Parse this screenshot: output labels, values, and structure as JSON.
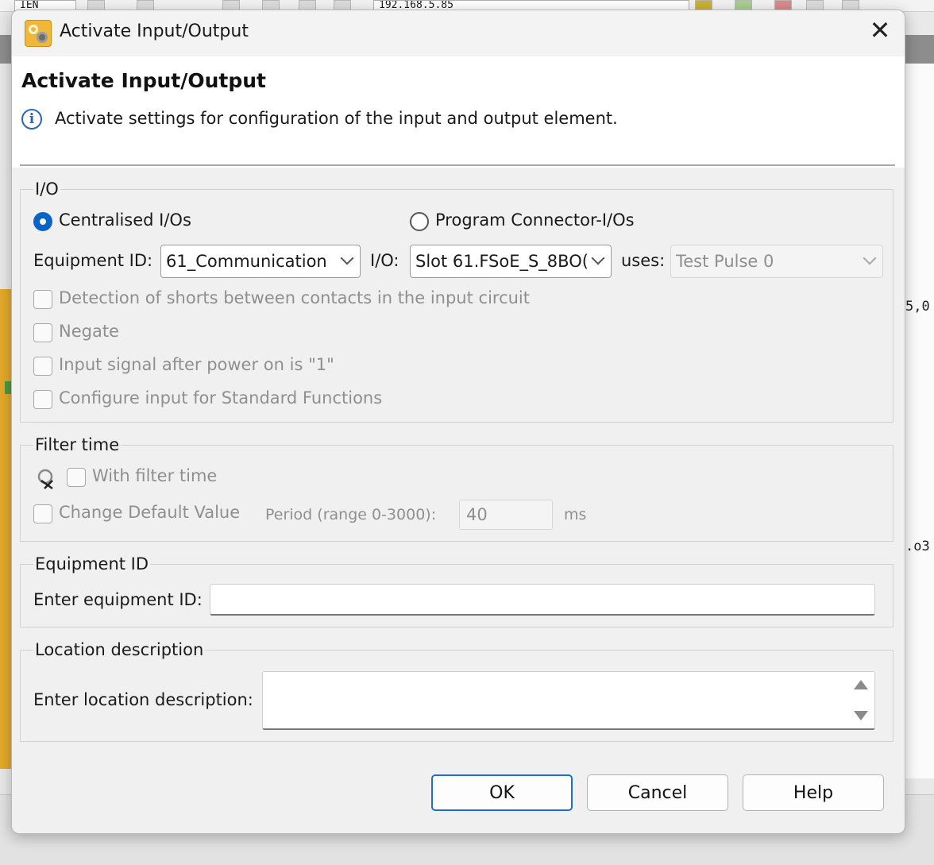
{
  "background": {
    "toolbar_combo_left": "IEN",
    "toolbar_ip": "192.168.5.85",
    "right_text_1": "5,0",
    "right_text_2": ".o3"
  },
  "dialog": {
    "title": "Activate Input/Output",
    "close_glyph": "✕",
    "heading": "Activate Input/Output",
    "info_glyph": "i",
    "description": "Activate settings for configuration of the input and output element."
  },
  "io": {
    "legend": "I/O",
    "radio_centralised": "Centralised I/Os",
    "radio_program_connector": "Program Connector-I/Os",
    "selected": "Centralised I/Os",
    "equipment_id_label": "Equipment ID:",
    "equipment_id_value": "61_Communication",
    "io_label": "I/O:",
    "io_value": "Slot 61.FSoE_S_8BO(",
    "uses_label": "uses:",
    "uses_value": "Test Pulse 0",
    "checkboxes": [
      "Detection of shorts between contacts in the input circuit",
      "Negate",
      "Input signal after power on is \"1\"",
      "Configure input for Standard Functions"
    ]
  },
  "filter": {
    "legend": "Filter time",
    "with_filter_time": "With filter time",
    "change_default": "Change Default Value",
    "period_label": "Period (range 0-3000):",
    "period_value": "40",
    "unit": "ms"
  },
  "equipment": {
    "legend": "Equipment ID",
    "label": "Enter equipment ID:",
    "value": ""
  },
  "location": {
    "legend": "Location description",
    "label": "Enter location description:",
    "value": ""
  },
  "buttons": {
    "ok": "OK",
    "cancel": "Cancel",
    "help": "Help"
  },
  "colors": {
    "accent": "#0a64c8",
    "primary_border": "#1f6fd0",
    "info_blue": "#2b64b8",
    "app_orange": "#e5a92a"
  }
}
